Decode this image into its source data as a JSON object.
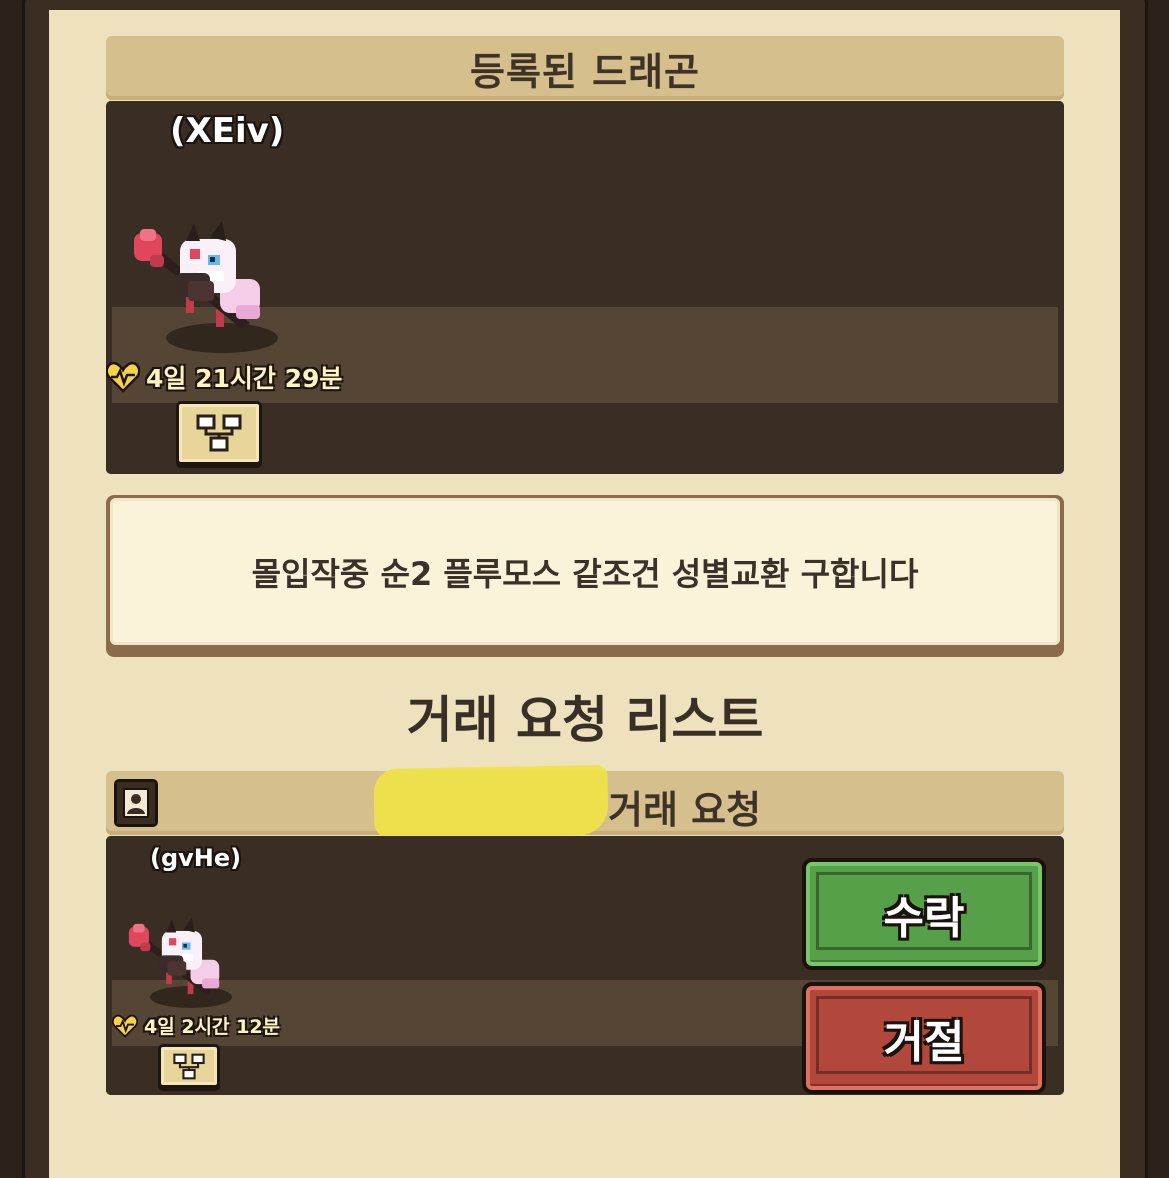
{
  "registered_section": {
    "title": "등록된 드래곤",
    "dragon_name": "(XEiv)",
    "timer": "4일 21시간 29분"
  },
  "message": "몰입작중 순2 플루모스 같조건 성별교환 구합니다",
  "request_list": {
    "title": "거래 요청 리스트",
    "request_label": "거래 요청",
    "requests": [
      {
        "dragon_name": "(gvHe)",
        "timer": "4일 2시간 12분",
        "accept_label": "수락",
        "reject_label": "거절"
      }
    ]
  },
  "colors": {
    "panel": "#ede2bd",
    "header": "#d5c08d",
    "accept": "#57a04a",
    "reject": "#b2473b",
    "highlight": "#efe24a"
  },
  "icons": [
    "heart-pulse-icon",
    "tree-icon",
    "profile-icon",
    "dragon-sprite"
  ]
}
